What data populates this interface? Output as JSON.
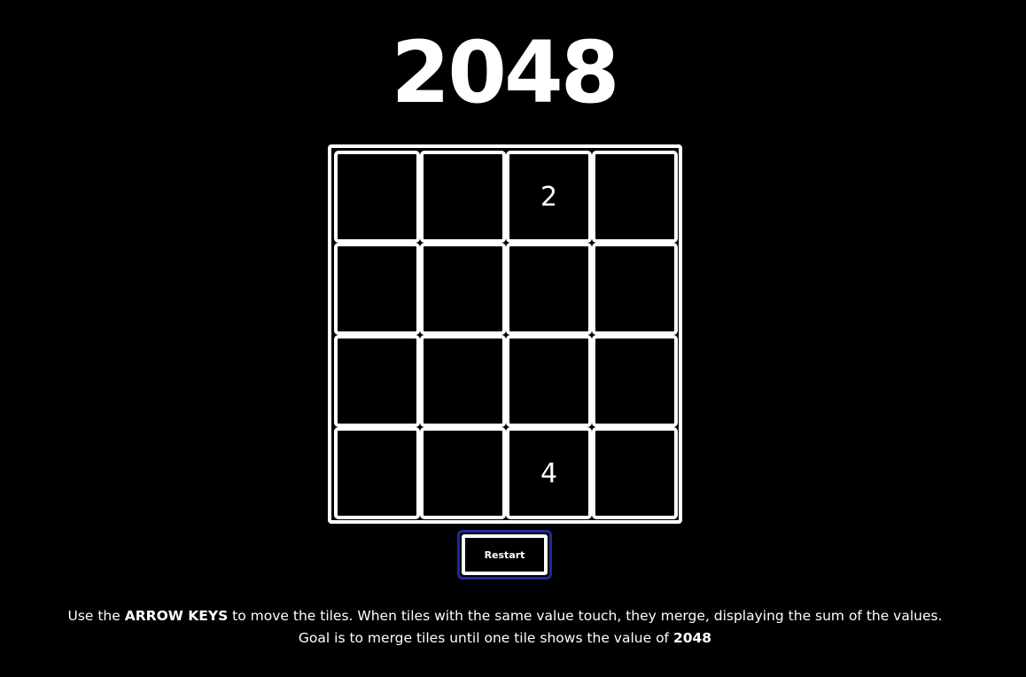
{
  "title": "2048",
  "board": {
    "rows": [
      [
        "",
        "",
        "2",
        ""
      ],
      [
        "",
        "",
        "",
        ""
      ],
      [
        "",
        "",
        "",
        ""
      ],
      [
        "",
        "",
        "4",
        ""
      ]
    ]
  },
  "restart_label": "Restart",
  "instructions": {
    "line1_prefix": "Use the ",
    "line1_keys": "ARROW KEYS",
    "line1_suffix": " to move the tiles. When tiles with the same value touch, they merge, displaying the sum of the values.",
    "line2_prefix": "Goal is to merge tiles until one tile shows the value of ",
    "line2_goal": "2048"
  },
  "colors": {
    "background": "#000000",
    "foreground": "#ffffff",
    "focus_ring": "#1f2a99"
  }
}
